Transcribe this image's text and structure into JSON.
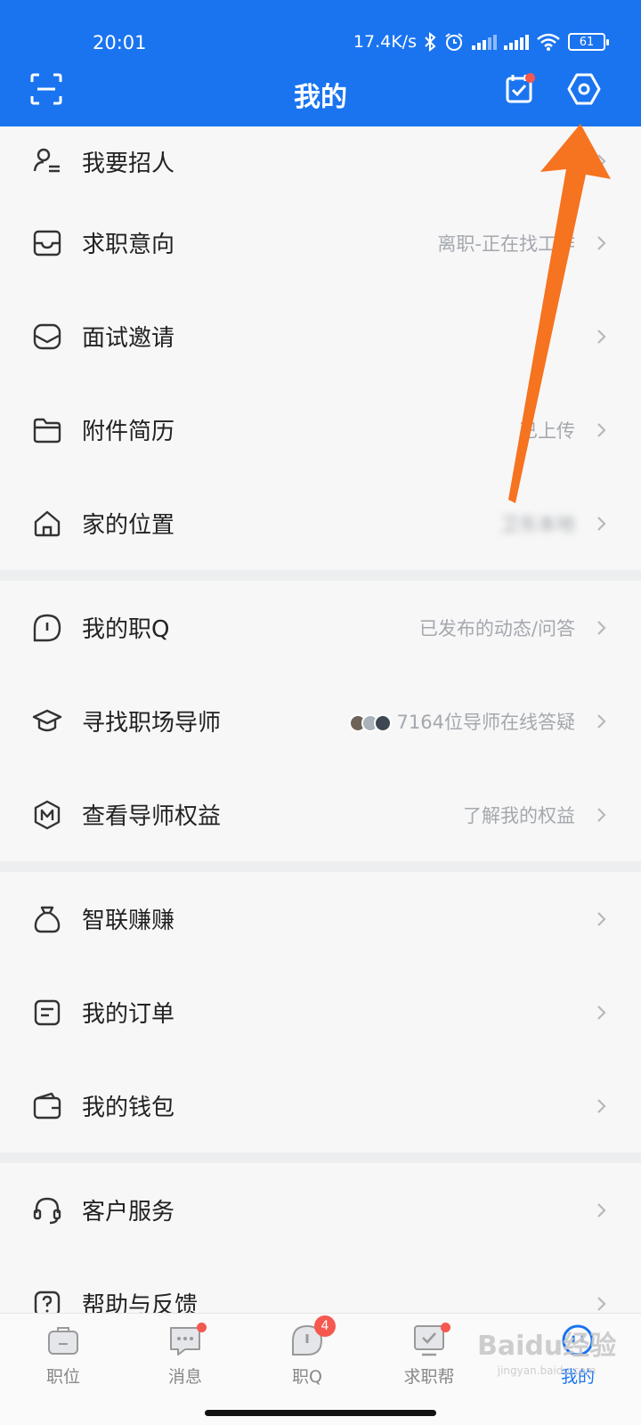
{
  "status_bar": {
    "time": "20:01",
    "net_speed": "17.4K/s",
    "battery": "61",
    "icons": [
      "bluetooth-icon",
      "alarm-icon",
      "signal-icon",
      "signal-hd-icon",
      "wifi-icon",
      "battery-icon"
    ]
  },
  "header": {
    "title": "我的",
    "bg_color": "#1a74f0",
    "left_icon": "scan-icon",
    "right_icons": [
      "checkin-calendar-icon",
      "settings-icon"
    ]
  },
  "menu": {
    "group1": [
      {
        "label": "我要招人",
        "sub": "",
        "icon": "recruit-icon"
      },
      {
        "label": "求职意向",
        "sub": "离职-正在找工作",
        "icon": "tray-icon"
      },
      {
        "label": "面试邀请",
        "sub": "",
        "icon": "envelope-icon"
      },
      {
        "label": "附件简历",
        "sub": "已上传",
        "icon": "folder-icon"
      },
      {
        "label": "家的位置",
        "sub": "卫东本地",
        "icon": "home-icon"
      }
    ],
    "group2": [
      {
        "label": "我的职Q",
        "sub": "已发布的动态/问答",
        "icon": "chat-bubble-icon"
      },
      {
        "label": "寻找职场导师",
        "sub": "7164位导师在线答疑",
        "icon": "graduation-cap-icon"
      },
      {
        "label": "查看导师权益",
        "sub": "了解我的权益",
        "icon": "badge-m-icon"
      }
    ],
    "group3": [
      {
        "label": "智联赚赚",
        "sub": "",
        "icon": "money-bag-icon"
      },
      {
        "label": "我的订单",
        "sub": "",
        "icon": "order-icon"
      },
      {
        "label": "我的钱包",
        "sub": "",
        "icon": "wallet-icon"
      }
    ],
    "group4": [
      {
        "label": "客户服务",
        "sub": "",
        "icon": "headset-icon"
      },
      {
        "label": "帮助与反馈",
        "sub": "",
        "icon": "help-icon"
      }
    ]
  },
  "tabbar": {
    "tabs": [
      {
        "label": "职位",
        "icon": "briefcase-icon",
        "badge": ""
      },
      {
        "label": "消息",
        "icon": "message-icon",
        "badge": "dot"
      },
      {
        "label": "职Q",
        "icon": "zhiq-icon",
        "badge": "4"
      },
      {
        "label": "求职帮",
        "icon": "help-board-icon",
        "badge": "dot"
      },
      {
        "label": "我的",
        "icon": "profile-face-icon",
        "badge": ""
      }
    ],
    "active_color": "#1a74f0"
  },
  "annotation": {
    "arrow_color": "#f6731f",
    "points_to": "settings-icon"
  },
  "watermark": {
    "text": "Baidu经验",
    "sub": "jingyan.baidu.com"
  }
}
